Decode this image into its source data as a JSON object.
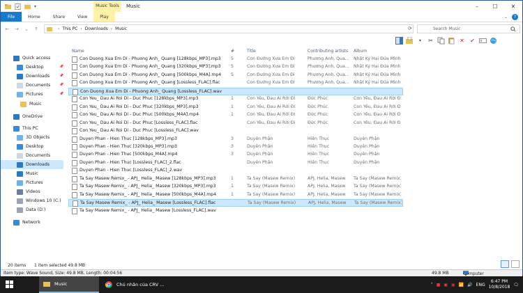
{
  "window": {
    "title": "Music",
    "tools_label": "Music Tools",
    "buttons": [
      "–",
      "☐",
      "✕"
    ]
  },
  "ribbon": {
    "tabs": [
      "File",
      "Home",
      "Share",
      "View",
      "Play"
    ]
  },
  "address": {
    "path": [
      "This PC",
      "Downloads",
      "Music"
    ],
    "search_placeholder": "Search Music"
  },
  "nav": {
    "items": [
      {
        "label": "Quick access",
        "icon": "star-icon",
        "indent": 0
      },
      {
        "label": "Desktop",
        "icon": "desktop-icon",
        "indent": 1,
        "pinned": true
      },
      {
        "label": "Downloads",
        "icon": "download-icon",
        "indent": 1,
        "pinned": true
      },
      {
        "label": "Documents",
        "icon": "document-icon",
        "indent": 1,
        "pinned": true
      },
      {
        "label": "Pictures",
        "icon": "picture-icon",
        "indent": 1,
        "pinned": true
      },
      {
        "label": "Music",
        "icon": "folder-icon",
        "indent": 2
      },
      {
        "label": "OneDrive",
        "icon": "cloud-icon",
        "indent": 0
      },
      {
        "label": "This PC",
        "icon": "pc-icon",
        "indent": 0
      },
      {
        "label": "3D Objects",
        "icon": "cube-icon",
        "indent": 1
      },
      {
        "label": "Desktop",
        "icon": "desktop-icon",
        "indent": 1
      },
      {
        "label": "Documents",
        "icon": "document-icon",
        "indent": 1
      },
      {
        "label": "Downloads",
        "icon": "download-icon",
        "indent": 1,
        "selected": true
      },
      {
        "label": "Music",
        "icon": "music-icon",
        "indent": 1
      },
      {
        "label": "Pictures",
        "icon": "picture-icon",
        "indent": 1
      },
      {
        "label": "Videos",
        "icon": "video-icon",
        "indent": 1
      },
      {
        "label": "Windows 10 (C:)",
        "icon": "drive-icon",
        "indent": 1
      },
      {
        "label": "Data (D:)",
        "icon": "drive-icon",
        "indent": 1
      },
      {
        "label": "Network",
        "icon": "network-icon",
        "indent": 0
      }
    ]
  },
  "list": {
    "columns": [
      "Name",
      "#",
      "Title",
      "Contributing artists",
      "Album"
    ],
    "rows": [
      {
        "name": "Con Duong Xua Em Di - Phuong Anh_ Quang [128kbps_MP3].mp3",
        "num": "5",
        "title": "Con Đường Xưa Em Đi",
        "artist": "Phương Anh, Qua...",
        "album": "Nhật Ký Hai Đứa Mình"
      },
      {
        "name": "Con Duong Xua Em Di - Phuong Anh_ Quang [320kbps_MP3].mp3",
        "num": "5",
        "title": "Con Đường Xưa Em Đi",
        "artist": "Phương Anh, Qua...",
        "album": "Nhật Ký Hai Đứa Mình"
      },
      {
        "name": "Con Duong Xua Em Di - Phuong Anh_ Quang [500kbps_M4A].mp4",
        "num": "5",
        "title": "Con Đường Xưa Em Đi",
        "artist": "Phương Anh, Qua...",
        "album": "Nhật Ký Hai Đứa Mình"
      },
      {
        "name": "Con Duong Xua Em Di - Phuong Anh_ Quang [Lossless_FLAC].flac",
        "num": "",
        "title": "Con Đường Xưa Em Đi",
        "artist": "Phương Anh, Qua...",
        "album": "Nhật Ký Hai Đứa Mình"
      },
      {
        "name": "Con Duong Xua Em Di - Phuong Anh_ Quang [Lossless_FLAC].wav",
        "num": "",
        "title": "",
        "artist": "",
        "album": "",
        "selected": true
      },
      {
        "name": "Con Yeu_ Dau Ai Roi Di - Duc Phuc [128kbps_MP3].mp3",
        "num": "1",
        "title": "Con Yêu, Đau Ai Rời Đi",
        "artist": "Đức Phúc",
        "album": "Con Yêu, Đau Ai Rời Đi"
      },
      {
        "name": "Con Yeu_ Dau Ai Roi Di - Duc Phuc [320kbps_MP3].mp3",
        "num": "1",
        "title": "Con Yêu, Đau Ai Rời Đi",
        "artist": "Đức Phúc",
        "album": "Con Yêu, Đau Ai Rời Đi"
      },
      {
        "name": "Con Yeu_ Dau Ai Roi Di - Duc Phuc [500kbps_M4A].mp4",
        "num": "1",
        "title": "Con Yêu, Đau Ai Rời Đi",
        "artist": "Đức Phúc",
        "album": "Con Yêu, Đau Ai Rời Đi"
      },
      {
        "name": "Con Yeu_ Dau Ai Roi Di - Duc Phuc [Lossless_FLAC].flac",
        "num": "",
        "title": "Con Yêu, Đau Ai Rời Đi",
        "artist": "Đức Phúc",
        "album": "Con Yêu, Đau Ai Rời Đi"
      },
      {
        "name": "Con Yeu_ Dau Ai Roi Di - Duc Phuc [Lossless_FLAC].wav",
        "num": "",
        "title": "",
        "artist": "",
        "album": ""
      },
      {
        "name": "Duyen Phan - Hien Thuc [128kbps_MP3].mp3",
        "num": "3",
        "title": "Duyên Phận",
        "artist": "Hiền Thục",
        "album": "Duyên Phận"
      },
      {
        "name": "Duyen Phan - Hien Thuc [320kbps_MP3].mp3",
        "num": "3",
        "title": "Duyên Phận",
        "artist": "Hiền Thục",
        "album": "Duyên Phận"
      },
      {
        "name": "Duyen Phan - Hien Thuc [500kbps_M4A].mp4",
        "num": "3",
        "title": "Duyên Phận",
        "artist": "Hiền Thục",
        "album": "Duyên Phận"
      },
      {
        "name": "Duyen Phan - Hien Thuc [Lossless_FLAC]_2.flac",
        "num": "",
        "title": "Duyên Phận",
        "artist": "Hiền Thục",
        "album": "Duyên Phận"
      },
      {
        "name": "Duyen Phan - Hien Thuc [Lossless_FLAC]_2.wav",
        "num": "",
        "title": "",
        "artist": "",
        "album": ""
      },
      {
        "name": "Ta Say Masew Remix_ - APJ_ Helia_ Masew [128kbps_MP3].mp3",
        "num": "1",
        "title": "Ta Say (Masew Remix)",
        "artist": "APJ, Helia, Masew",
        "album": "Ta Say (Masew Remix)"
      },
      {
        "name": "Ta Say Masew Remix_ - APJ_ Helia_ Masew [320kbps_MP3].mp3",
        "num": "1",
        "title": "Ta Say (Masew Remix)",
        "artist": "APJ, Helia, Masew",
        "album": "Ta Say (Masew Remix)"
      },
      {
        "name": "Ta Say Masew Remix_ - APJ_ Helia_ Masew [500kbps_M4A].mp4",
        "num": "1",
        "title": "Ta Say (Masew Remix)",
        "artist": "APJ, Helia, Masew",
        "album": "Ta Say (Masew Remix)"
      },
      {
        "name": "Ta Say Masew Remix_ - APJ_ Helia_ Masew [Lossless_FLAC].flac",
        "num": "",
        "title": "Ta Say (Masew Remix)",
        "artist": "APJ, Helia, Masew",
        "album": "Ta Say (Masew Remix)",
        "hover": true
      },
      {
        "name": "Ta Say Masew Remix_ - APJ_ Helia_ Masew [Lossless_FLAC].wav",
        "num": "",
        "title": "",
        "artist": "",
        "album": ""
      }
    ]
  },
  "status": {
    "count": "20 items",
    "selected": "1 item selected  49.8 MB",
    "details": "Item type: Wave Sound, Size: 49.8 MB, Length: 00:04:56",
    "size_right": "49.8 MB",
    "location": "Computer"
  },
  "taskbar": {
    "items": [
      {
        "label": "Music",
        "active": true
      },
      {
        "label": "Chủ nhân của CRV ..."
      }
    ],
    "lang": "ENG",
    "time": "6:47 PM",
    "date": "10/8/2018"
  },
  "colors": {
    "accent": "#1979ca",
    "selection": "#cce8ff",
    "tools": "#fff2a8"
  }
}
